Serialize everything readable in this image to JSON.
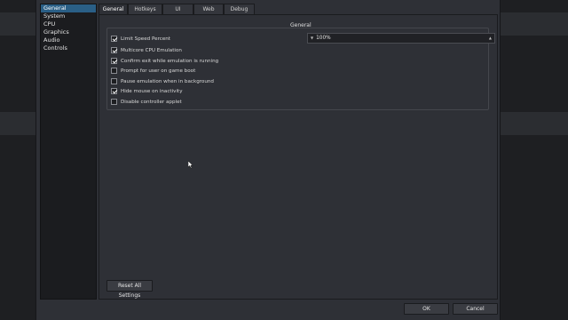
{
  "sidebar": {
    "items": [
      {
        "label": "General",
        "active": true
      },
      {
        "label": "System",
        "active": false
      },
      {
        "label": "CPU",
        "active": false
      },
      {
        "label": "Graphics",
        "active": false
      },
      {
        "label": "Audio",
        "active": false
      },
      {
        "label": "Controls",
        "active": false
      }
    ]
  },
  "tabs": [
    {
      "label": "General",
      "active": true
    },
    {
      "label": "Hotkeys",
      "active": false
    },
    {
      "label": "UI",
      "active": false
    },
    {
      "label": "Web",
      "active": false
    },
    {
      "label": "Debug",
      "active": false
    }
  ],
  "general": {
    "group_title": "General",
    "speed_value": "100%",
    "options": [
      {
        "label": "Limit Speed Percent",
        "checked": true
      },
      {
        "label": "Multicore CPU Emulation",
        "checked": true
      },
      {
        "label": "Confirm exit while emulation is running",
        "checked": true
      },
      {
        "label": "Prompt for user on game boot",
        "checked": false
      },
      {
        "label": "Pause emulation when in background",
        "checked": false
      },
      {
        "label": "Hide mouse on inactivity",
        "checked": true
      },
      {
        "label": "Disable controller applet",
        "checked": false
      }
    ],
    "reset_label": "Reset All Settings"
  },
  "footer": {
    "ok_label": "OK",
    "cancel_label": "Cancel"
  }
}
